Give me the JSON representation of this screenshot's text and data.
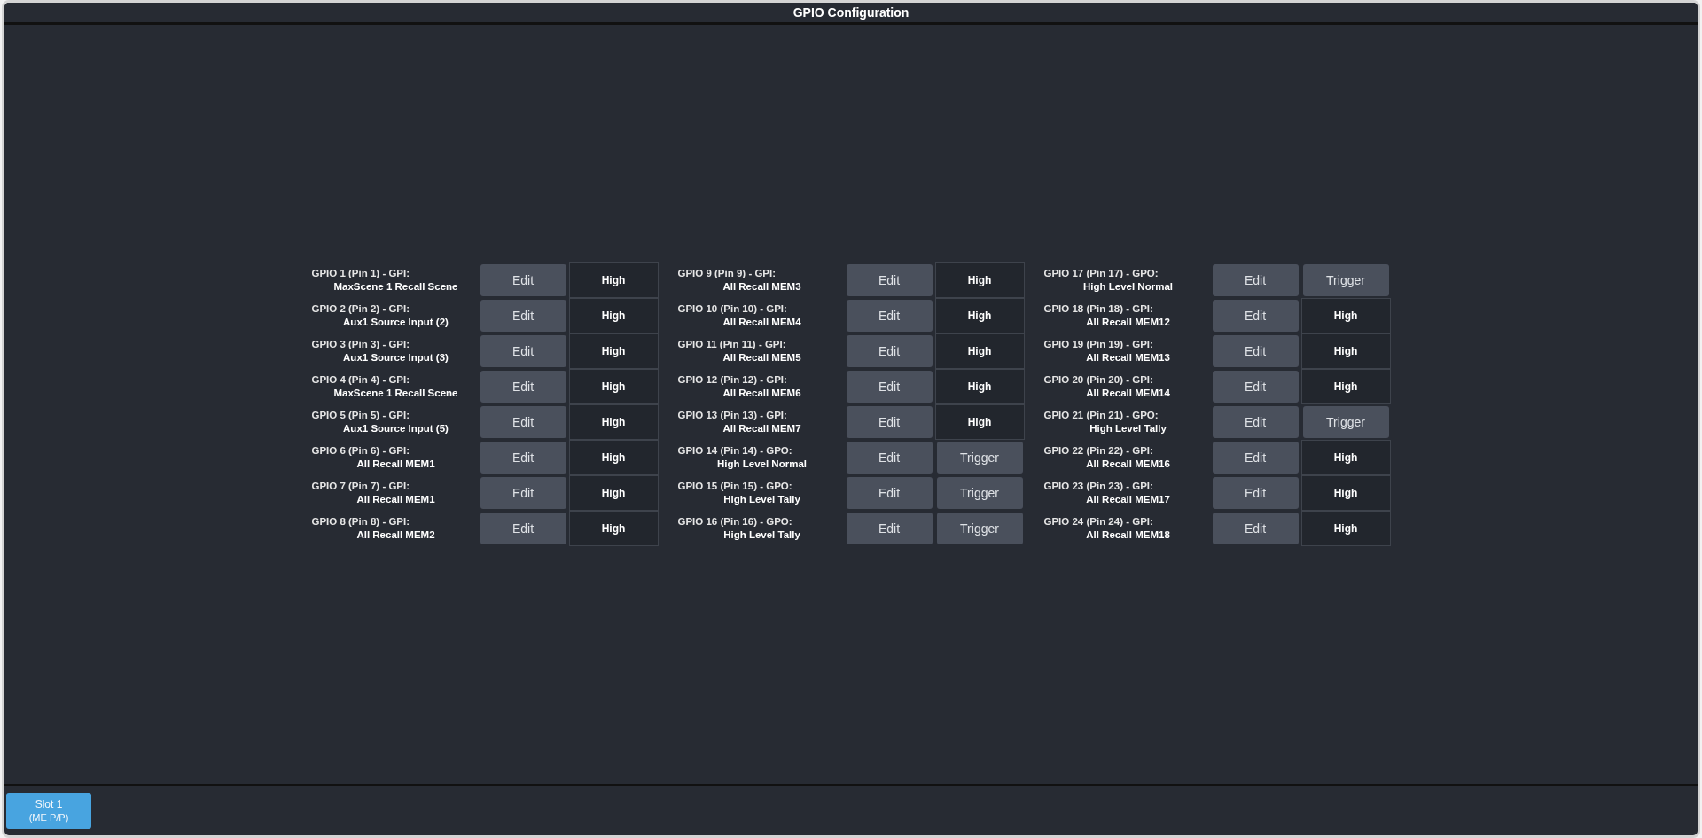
{
  "window": {
    "title": "GPIO Configuration"
  },
  "columns": [
    {
      "rows": [
        {
          "name": "GPIO 1 (Pin 1) - GPI:",
          "function": "MaxScene 1 Recall Scene",
          "edit": "Edit",
          "kind": "state",
          "status": "High"
        },
        {
          "name": "GPIO 2 (Pin 2) - GPI:",
          "function": "Aux1 Source Input (2)",
          "edit": "Edit",
          "kind": "state",
          "status": "High"
        },
        {
          "name": "GPIO 3 (Pin 3) - GPI:",
          "function": "Aux1 Source Input (3)",
          "edit": "Edit",
          "kind": "state",
          "status": "High"
        },
        {
          "name": "GPIO 4 (Pin 4) - GPI:",
          "function": "MaxScene 1 Recall Scene",
          "edit": "Edit",
          "kind": "state",
          "status": "High"
        },
        {
          "name": "GPIO 5 (Pin 5) - GPI:",
          "function": "Aux1 Source Input (5)",
          "edit": "Edit",
          "kind": "state",
          "status": "High"
        },
        {
          "name": "GPIO 6 (Pin 6) - GPI:",
          "function": "All Recall MEM1",
          "edit": "Edit",
          "kind": "state",
          "status": "High"
        },
        {
          "name": "GPIO 7 (Pin 7) - GPI:",
          "function": "All Recall MEM1",
          "edit": "Edit",
          "kind": "state",
          "status": "High"
        },
        {
          "name": "GPIO 8 (Pin 8) - GPI:",
          "function": "All Recall MEM2",
          "edit": "Edit",
          "kind": "state",
          "status": "High"
        }
      ]
    },
    {
      "rows": [
        {
          "name": "GPIO 9 (Pin 9) - GPI:",
          "function": "All Recall MEM3",
          "edit": "Edit",
          "kind": "state",
          "status": "High"
        },
        {
          "name": "GPIO 10 (Pin 10) - GPI:",
          "function": "All Recall MEM4",
          "edit": "Edit",
          "kind": "state",
          "status": "High"
        },
        {
          "name": "GPIO 11 (Pin 11) - GPI:",
          "function": "All Recall MEM5",
          "edit": "Edit",
          "kind": "state",
          "status": "High"
        },
        {
          "name": "GPIO 12 (Pin 12) - GPI:",
          "function": "All Recall MEM6",
          "edit": "Edit",
          "kind": "state",
          "status": "High"
        },
        {
          "name": "GPIO 13 (Pin 13) - GPI:",
          "function": "All Recall MEM7",
          "edit": "Edit",
          "kind": "state",
          "status": "High"
        },
        {
          "name": "GPIO 14 (Pin 14) - GPO:",
          "function": "High Level Normal",
          "edit": "Edit",
          "kind": "trigger",
          "status": "Trigger"
        },
        {
          "name": "GPIO 15 (Pin 15) - GPO:",
          "function": "High Level Tally",
          "edit": "Edit",
          "kind": "trigger",
          "status": "Trigger"
        },
        {
          "name": "GPIO 16 (Pin 16) - GPO:",
          "function": "High Level Tally",
          "edit": "Edit",
          "kind": "trigger",
          "status": "Trigger"
        }
      ]
    },
    {
      "rows": [
        {
          "name": "GPIO 17 (Pin 17) - GPO:",
          "function": "High Level Normal",
          "edit": "Edit",
          "kind": "trigger",
          "status": "Trigger"
        },
        {
          "name": "GPIO 18 (Pin 18) - GPI:",
          "function": "All Recall MEM12",
          "edit": "Edit",
          "kind": "state",
          "status": "High"
        },
        {
          "name": "GPIO 19 (Pin 19) - GPI:",
          "function": "All Recall MEM13",
          "edit": "Edit",
          "kind": "state",
          "status": "High"
        },
        {
          "name": "GPIO 20 (Pin 20) - GPI:",
          "function": "All Recall MEM14",
          "edit": "Edit",
          "kind": "state",
          "status": "High"
        },
        {
          "name": "GPIO 21 (Pin 21) - GPO:",
          "function": "High Level Tally",
          "edit": "Edit",
          "kind": "trigger",
          "status": "Trigger"
        },
        {
          "name": "GPIO 22 (Pin 22) - GPI:",
          "function": "All Recall MEM16",
          "edit": "Edit",
          "kind": "state",
          "status": "High"
        },
        {
          "name": "GPIO 23 (Pin 23) - GPI:",
          "function": "All Recall MEM17",
          "edit": "Edit",
          "kind": "state",
          "status": "High"
        },
        {
          "name": "GPIO 24 (Pin 24) - GPI:",
          "function": "All Recall MEM18",
          "edit": "Edit",
          "kind": "state",
          "status": "High"
        }
      ]
    }
  ],
  "slots": [
    {
      "label": "Slot 1",
      "sublabel": "(ME P/P)",
      "selected": true
    }
  ]
}
